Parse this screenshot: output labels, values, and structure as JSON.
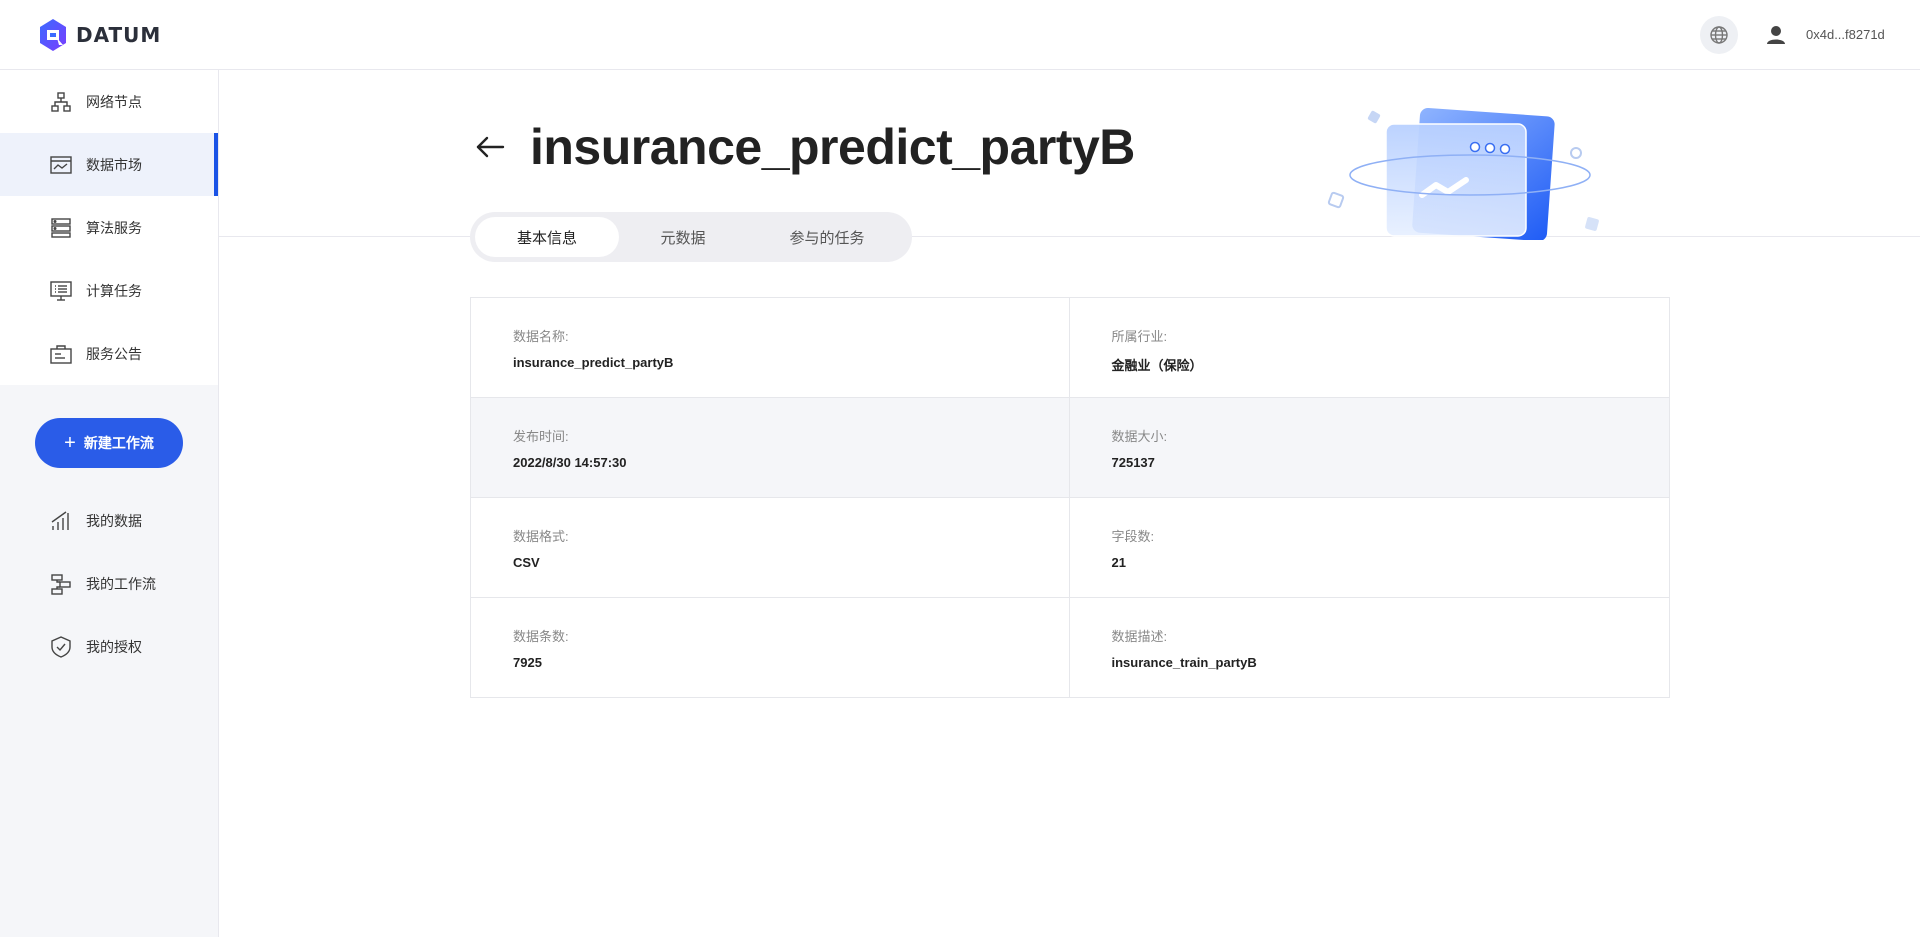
{
  "header": {
    "logo_text": "DATUM",
    "globe_icon": "globe-icon",
    "user_icon": "user-icon",
    "address": "0x4d...f8271d"
  },
  "sidebar": {
    "top_items": [
      {
        "label": "网络节点",
        "icon": "network-nodes-icon"
      },
      {
        "label": "数据市场",
        "icon": "data-market-icon",
        "active": true
      },
      {
        "label": "算法服务",
        "icon": "server-icon"
      },
      {
        "label": "计算任务",
        "icon": "task-list-icon"
      },
      {
        "label": "服务公告",
        "icon": "announcement-icon"
      }
    ],
    "new_workflow_label": "新建工作流",
    "bottom_items": [
      {
        "label": "我的数据",
        "icon": "bar-chart-icon"
      },
      {
        "label": "我的工作流",
        "icon": "workflow-icon"
      },
      {
        "label": "我的授权",
        "icon": "shield-check-icon"
      }
    ],
    "active_color": "#1a53e6"
  },
  "main": {
    "title": "insurance_predict_partyB",
    "tabs": [
      {
        "label": "基本信息",
        "active": true
      },
      {
        "label": "元数据"
      },
      {
        "label": "参与的任务"
      }
    ],
    "info": [
      {
        "label": "数据名称:",
        "value": "insurance_predict_partyB"
      },
      {
        "label": "所属行业:",
        "value": "金融业（保险）"
      },
      {
        "label": "发布时间:",
        "value": "2022/8/30 14:57:30"
      },
      {
        "label": "数据大小:",
        "value": "725137"
      },
      {
        "label": "数据格式:",
        "value": "CSV"
      },
      {
        "label": "字段数:",
        "value": "21"
      },
      {
        "label": "数据条数:",
        "value": "7925"
      },
      {
        "label": "数据描述:",
        "value": "insurance_train_partyB"
      }
    ]
  },
  "colors": {
    "primary": "#2a5ce8",
    "sidebar_bg": "#f5f6f9"
  }
}
